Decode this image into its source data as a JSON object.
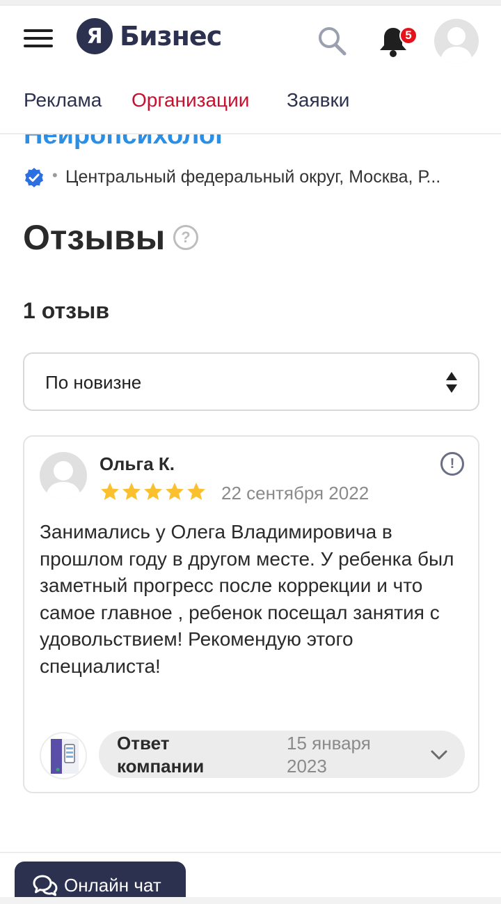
{
  "header": {
    "logo_letter": "Я",
    "logo_text": "Бизнес",
    "notification_count": "5"
  },
  "nav": {
    "tabs": [
      {
        "label": "Реклама",
        "active": false
      },
      {
        "label": "Организации",
        "active": true
      },
      {
        "label": "Заявки",
        "active": false
      }
    ]
  },
  "organization": {
    "name": "Нейропсихолог",
    "address": "Центральный федеральный округ, Москва, Р...",
    "verified": true
  },
  "reviews": {
    "title": "Отзывы",
    "help_symbol": "?",
    "count_label": "1 отзыв",
    "sort": {
      "selected": "По новизне"
    },
    "items": [
      {
        "author": "Ольга К.",
        "rating": 5,
        "rating_max": 5,
        "date": "22 сентября 2022",
        "text": "Занимались у Олега Владимировича в прошлом году в другом месте. У ребенка был заметный прогресс после коррекции и что самое главное , ребенок посещал занятия с удовольствием! Рекомендую этого специалиста!",
        "report_symbol": "!",
        "reply": {
          "label": "Ответ компании",
          "date": "15 января 2023"
        }
      }
    ]
  },
  "chat": {
    "label": "Онлайн чат"
  },
  "colors": {
    "brand_dark": "#2c3150",
    "active_tab": "#c8102e",
    "org_link": "#1e88e5",
    "star": "#fbc02d",
    "badge": "#e4121b"
  }
}
